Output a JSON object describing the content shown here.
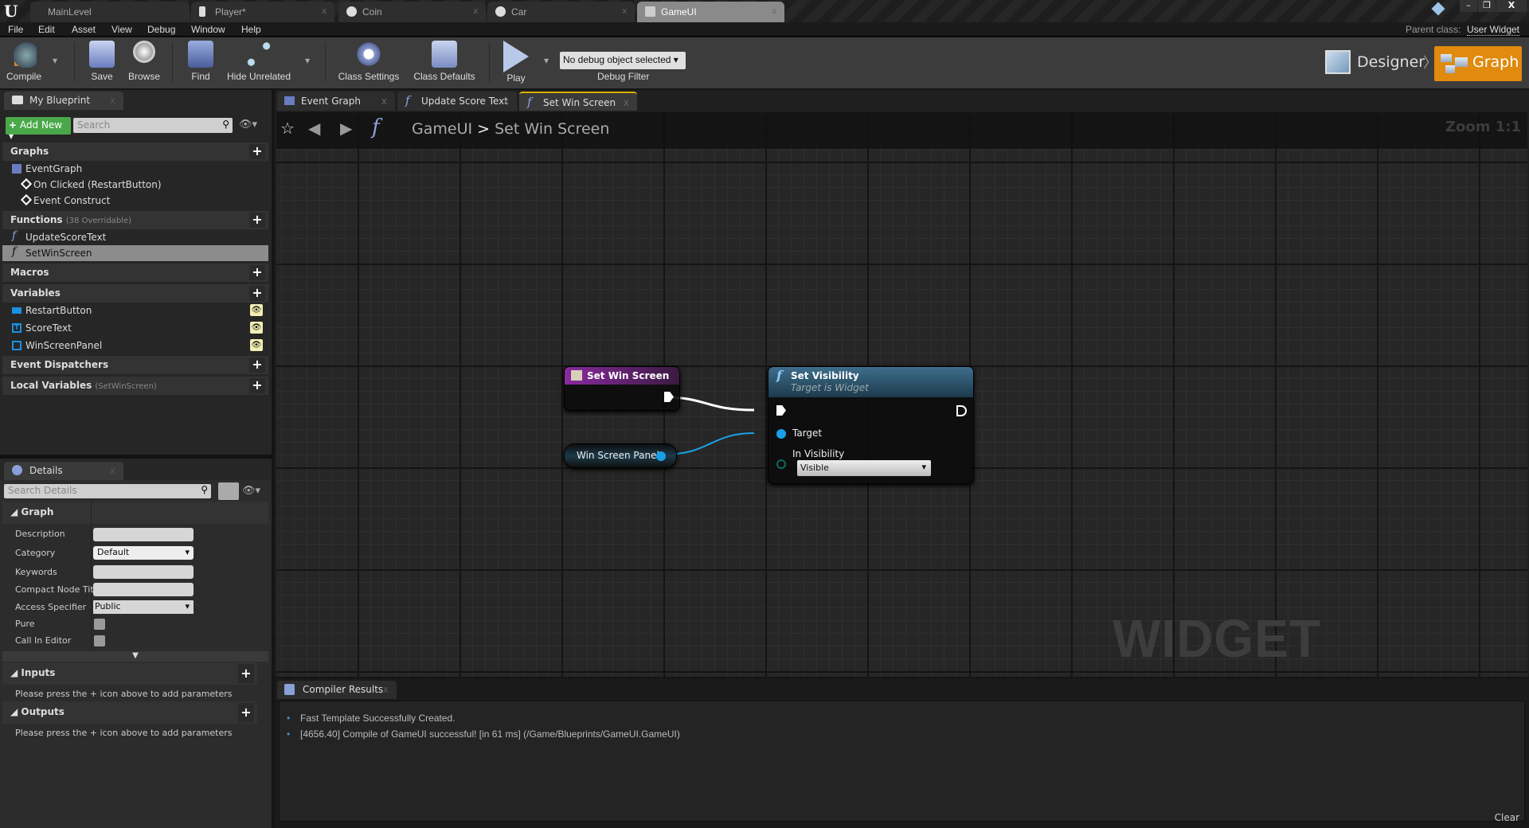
{
  "window": {
    "doc_tabs": [
      {
        "label": "MainLevel"
      },
      {
        "label": "Player*"
      },
      {
        "label": "Coin"
      },
      {
        "label": "Car"
      },
      {
        "label": "GameUI"
      }
    ],
    "active_tab": "GameUI",
    "close": "x",
    "min": "–",
    "max": "❐",
    "close_btn": "X"
  },
  "menu": [
    "File",
    "Edit",
    "Asset",
    "View",
    "Debug",
    "Window",
    "Help"
  ],
  "parent_class": {
    "label": "Parent class:",
    "value": "User Widget"
  },
  "toolbar": {
    "compile": "Compile",
    "save": "Save",
    "browse": "Browse",
    "find": "Find",
    "hide_unrelated": "Hide Unrelated",
    "class_settings": "Class Settings",
    "class_defaults": "Class Defaults",
    "play": "Play",
    "debug_select": "No debug object selected",
    "debug_filter": "Debug Filter",
    "designer": "Designer",
    "graph": "Graph"
  },
  "colors": {
    "accent": "#e08a0e",
    "add_new": "#4aa84a",
    "event_node": "#7a1f8c",
    "function_node": "#3a6c8a",
    "object_pin": "#1aa0e8"
  },
  "my_blueprint": {
    "tab": "My Blueprint",
    "add_new": "Add New",
    "search_placeholder": "Search",
    "graphs": {
      "title": "Graphs",
      "items": [
        "EventGraph",
        "On Clicked (RestartButton)",
        "Event Construct"
      ]
    },
    "functions": {
      "title": "Functions",
      "sub": "(38 Overridable)",
      "items": [
        "UpdateScoreText",
        "SetWinScreen"
      ],
      "selected": "SetWinScreen"
    },
    "macros": {
      "title": "Macros"
    },
    "variables": {
      "title": "Variables",
      "items": [
        "RestartButton",
        "ScoreText",
        "WinScreenPanel"
      ]
    },
    "event_dispatchers": {
      "title": "Event Dispatchers"
    },
    "local_variables": {
      "title": "Local Variables",
      "sub": "(SetWinScreen)"
    }
  },
  "details": {
    "tab": "Details",
    "search_placeholder": "Search Details",
    "graph_section": "Graph",
    "fields": {
      "description": "Description",
      "category": "Category",
      "category_value": "Default",
      "keywords": "Keywords",
      "compact": "Compact Node Titl",
      "access": "Access Specifier",
      "access_value": "Public",
      "pure": "Pure",
      "call_in_editor": "Call In Editor"
    },
    "inputs": "Inputs",
    "outputs": "Outputs",
    "hint": "Please press the + icon above to add parameters"
  },
  "graph": {
    "tabs": [
      "Event Graph",
      "Update Score Text",
      "Set Win Screen"
    ],
    "active": "Set Win Screen",
    "breadcrumb": {
      "root": "GameUI",
      "sep": ">",
      "current": "Set Win Screen"
    },
    "zoom": "Zoom 1:1",
    "watermark": "WIDGET BLUEPRINT",
    "nodes": {
      "entry": {
        "title": "Set Win Screen"
      },
      "var": {
        "title": "Win Screen Panel"
      },
      "call": {
        "title": "Set Visibility",
        "subtitle": "Target is Widget",
        "target": "Target",
        "in_visibility": "In Visibility",
        "visibility_value": "Visible"
      }
    }
  },
  "compiler": {
    "tab": "Compiler Results",
    "messages": [
      "Fast Template Successfully Created.",
      "[4656.40] Compile of GameUI successful! [in 61 ms] (/Game/Blueprints/GameUI.GameUI)"
    ],
    "clear": "Clear"
  }
}
